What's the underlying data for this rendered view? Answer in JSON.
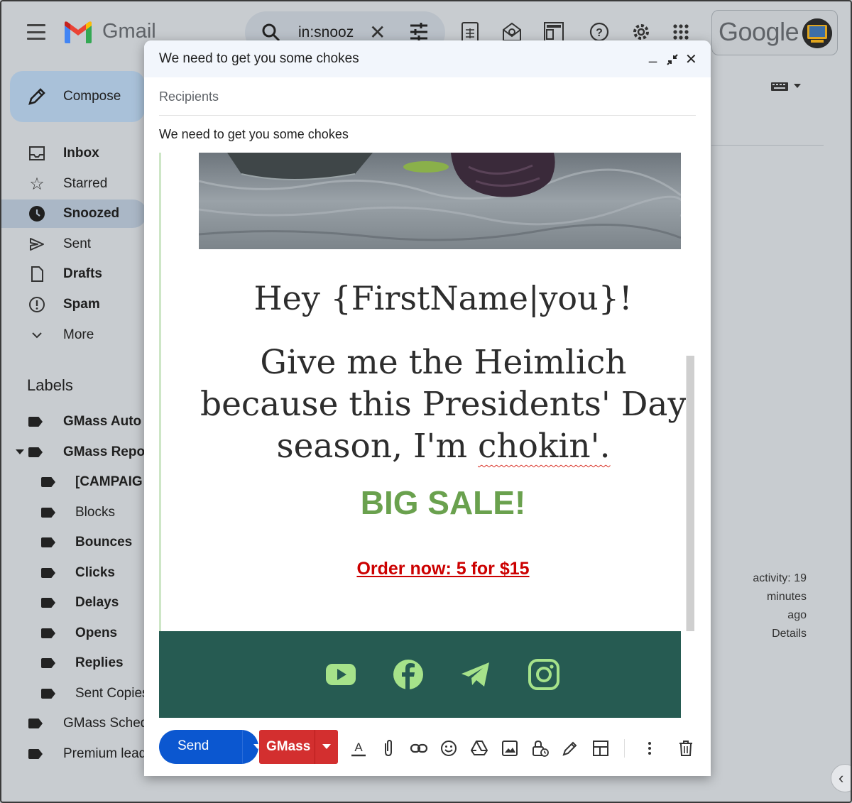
{
  "app": {
    "name": "Gmail",
    "google_label": "Google"
  },
  "search": {
    "query": "in:snooz"
  },
  "sidebar": {
    "compose_label": "Compose",
    "items": [
      {
        "label": "Inbox",
        "bold": true
      },
      {
        "label": "Starred",
        "bold": false
      },
      {
        "label": "Snoozed",
        "bold": true,
        "active": true
      },
      {
        "label": "Sent",
        "bold": false
      },
      {
        "label": "Drafts",
        "bold": true
      },
      {
        "label": "Spam",
        "bold": true
      },
      {
        "label": "More",
        "bold": false
      }
    ],
    "labels_title": "Labels",
    "labels": [
      {
        "label": "GMass Auto",
        "bold": true
      },
      {
        "label": "GMass Repo",
        "bold": true
      },
      {
        "label": "[CAMPAIG",
        "bold": true
      },
      {
        "label": "Blocks",
        "bold": false
      },
      {
        "label": "Bounces",
        "bold": true
      },
      {
        "label": "Clicks",
        "bold": true
      },
      {
        "label": "Delays",
        "bold": true
      },
      {
        "label": "Opens",
        "bold": true
      },
      {
        "label": "Replies",
        "bold": true
      },
      {
        "label": "Sent Copies",
        "bold": false
      },
      {
        "label": "GMass Sched",
        "bold": false
      },
      {
        "label": "Premium lead",
        "bold": false
      }
    ]
  },
  "background": {
    "activity_line1": "activity: 19 minutes",
    "activity_line2": "ago",
    "details_link": "Details"
  },
  "compose": {
    "title": "We need to get you some chokes",
    "recipients_placeholder": "Recipients",
    "subject": "We need to get you some chokes",
    "body": {
      "greeting": "Hey {FirstName|you}!",
      "line_main": "Give me the Heimlich because this Presidents' Day season, I'm",
      "line_misspelled": "chokin'.",
      "sale_heading": "BIG SALE!",
      "order_link": "Order now: 5 for $15",
      "social_icons": [
        "youtube-icon",
        "facebook-icon",
        "telegram-icon",
        "instagram-icon"
      ]
    },
    "send_label": "Send",
    "gmass_label": "GMass",
    "toolbar_icons": [
      "format-text-icon",
      "attach-icon",
      "link-icon",
      "emoji-icon",
      "drive-icon",
      "photo-icon",
      "confidential-lock-icon",
      "signature-pen-icon",
      "layout-icon",
      "more-options-icon",
      "trash-icon"
    ]
  },
  "colors": {
    "send_blue": "#0b57d0",
    "gmass_red": "#d32f2f",
    "sale_green": "#6aa14e",
    "order_red": "#cc0000",
    "footer_green": "#265b52",
    "social_icon_green": "#a6e28a"
  }
}
